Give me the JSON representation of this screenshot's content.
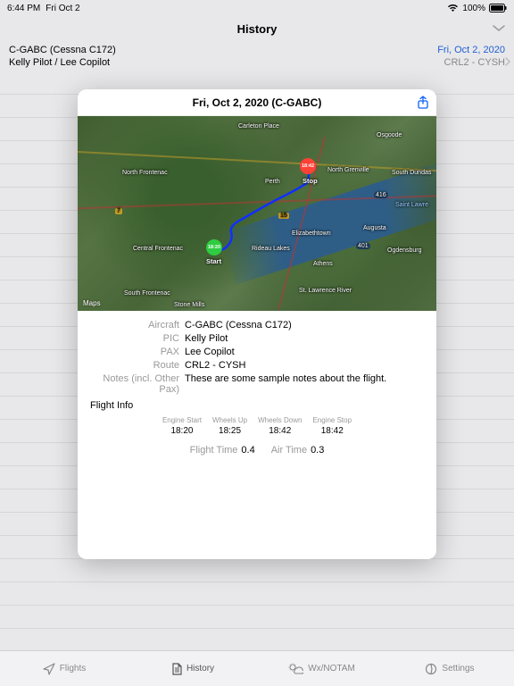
{
  "status": {
    "time": "6:44 PM",
    "date": "Fri Oct 2",
    "battery": "100%"
  },
  "nav": {
    "title": "History"
  },
  "list": {
    "aircraft": "C-GABC (Cessna C172)",
    "date": "Fri, Oct 2, 2020",
    "crew": "Kelly Pilot / Lee Copilot",
    "route": "CRL2 - CYSH"
  },
  "card": {
    "title": "Fri, Oct 2, 2020 (C-GABC)",
    "attribution": "Maps"
  },
  "map_labels": {
    "carleton": "Carleton Place",
    "osgoode": "Osgoode",
    "northgrenville": "North Grenville",
    "perth": "Perth",
    "northfrontenac": "North Frontenac",
    "southdundas": "South Dundas",
    "centralfrontenac": "Central Frontenac",
    "rideau": "Rideau Lakes",
    "elizabethtown": "Elizabethtown",
    "augusta": "Augusta",
    "athens": "Athens",
    "ogdensburg": "Ogdensburg",
    "southfrontenac": "South Frontenac",
    "stonemills": "Stone Mills",
    "stlawrence": "St. Lawrence River",
    "saintlawre": "Saint Lawre",
    "n7": "7",
    "n15": "15",
    "n416": "416",
    "n401": "401"
  },
  "markers": {
    "start_time": "18:20",
    "start_label": "Start",
    "stop_time": "18:42",
    "stop_label": "Stop"
  },
  "details": {
    "aircraft_label": "Aircraft",
    "aircraft": "C-GABC (Cessna C172)",
    "pic_label": "PIC",
    "pic": "Kelly Pilot",
    "pax_label": "PAX",
    "pax": "Lee Copilot",
    "route_label": "Route",
    "route": "CRL2 - CYSH",
    "notes_label": "Notes (incl. Other Pax)",
    "notes": "These are some sample notes about the flight.",
    "section": "Flight Info"
  },
  "times": {
    "engine_start_label": "Engine Start",
    "engine_start": "18:20",
    "wheels_up_label": "Wheels Up",
    "wheels_up": "18:25",
    "wheels_down_label": "Wheels Down",
    "wheels_down": "18:42",
    "engine_stop_label": "Engine Stop",
    "engine_stop": "18:42"
  },
  "summary": {
    "flight_time_label": "Flight Time",
    "flight_time": "0.4",
    "air_time_label": "Air Time",
    "air_time": "0.3"
  },
  "tabs": {
    "flights": "Flights",
    "history": "History",
    "wx": "Wx/NOTAM",
    "settings": "Settings"
  }
}
